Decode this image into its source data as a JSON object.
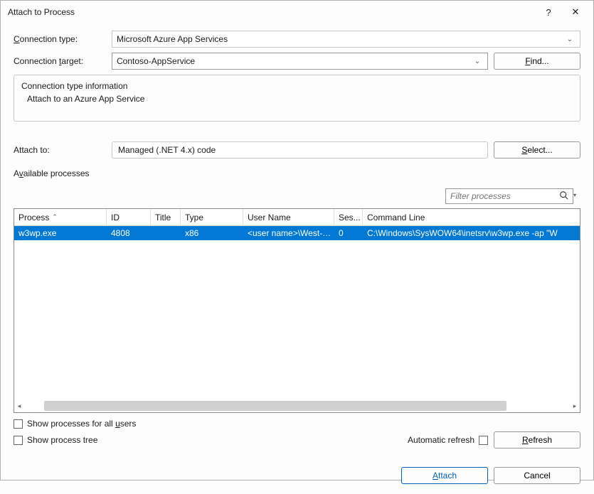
{
  "window": {
    "title": "Attach to Process",
    "help_icon": "?",
    "close_icon": "✕"
  },
  "form": {
    "connection_type_label_pre": "",
    "connection_type_label_u": "C",
    "connection_type_label_post": "onnection type:",
    "connection_type_value": "Microsoft Azure App Services",
    "connection_target_label_pre": "Connection ",
    "connection_target_label_u": "t",
    "connection_target_label_post": "arget:",
    "connection_target_value": "Contoso-AppService",
    "find_label_pre": "",
    "find_label_u": "F",
    "find_label_post": "ind...",
    "info_title": "Connection type information",
    "info_text": "Attach to an Azure App Service",
    "attach_to_label": "Attach to:",
    "attach_to_value": "Managed (.NET 4.x) code",
    "select_label_pre": "",
    "select_label_u": "S",
    "select_label_post": "elect..."
  },
  "processes": {
    "group_label_pre": "A",
    "group_label_u": "v",
    "group_label_post": "ailable processes",
    "filter_placeholder": "Filter processes",
    "columns": {
      "process": "Process",
      "id": "ID",
      "title": "Title",
      "type": "Type",
      "user": "User Name",
      "session": "Ses...",
      "cmd": "Command Line"
    },
    "rows": [
      {
        "process": "w3wp.exe",
        "id": "4808",
        "title": "",
        "type": "x86",
        "user": "<user name>\\West-…",
        "session": "0",
        "cmd": "C:\\Windows\\SysWOW64\\inetsrv\\w3wp.exe -ap \"W"
      }
    ]
  },
  "options": {
    "show_all_pre": "Show processes for all ",
    "show_all_u": "u",
    "show_all_post": "sers",
    "show_tree": "Show process tree",
    "auto_refresh": "Automatic refresh",
    "refresh_label_u": "R",
    "refresh_label_post": "efresh"
  },
  "actions": {
    "attach_u": "A",
    "attach_post": "ttach",
    "cancel": "Cancel"
  }
}
